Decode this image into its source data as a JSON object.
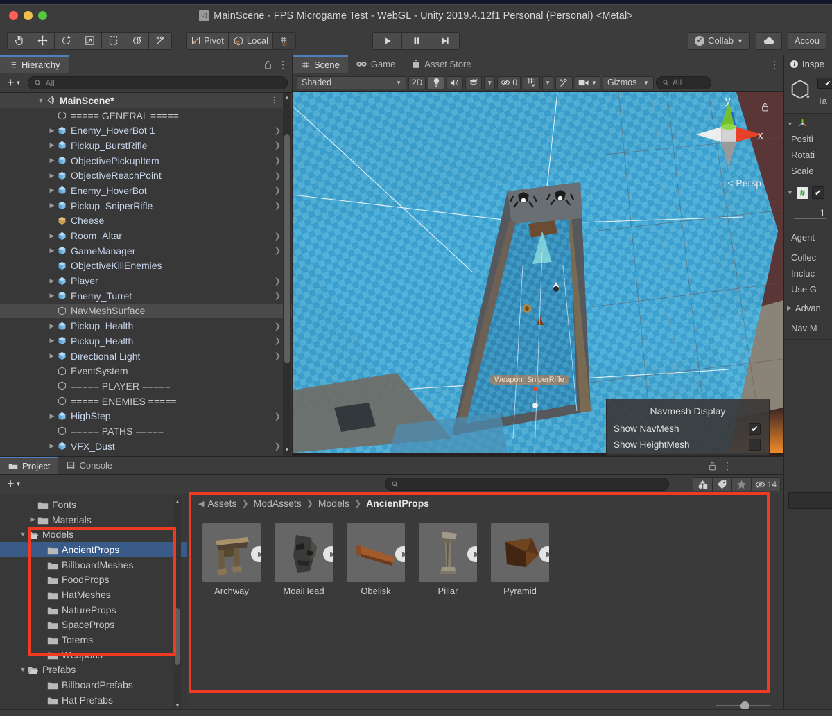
{
  "window": {
    "title": "MainScene - FPS Microgame Test - WebGL - Unity 2019.4.12f1 Personal (Personal) <Metal>",
    "logo_icon": "unity-logo-icon"
  },
  "toolbar": {
    "tools": [
      {
        "name": "hand-tool",
        "icon": "hand-icon"
      },
      {
        "name": "move-tool",
        "icon": "move-icon"
      },
      {
        "name": "rotate-tool",
        "icon": "rotate-icon"
      },
      {
        "name": "scale-tool",
        "icon": "scale-icon"
      },
      {
        "name": "rect-tool",
        "icon": "rect-transform-icon"
      },
      {
        "name": "transform-tool",
        "icon": "transform-icon"
      },
      {
        "name": "custom-editor-tool",
        "icon": "wrench-icon"
      }
    ],
    "pivot_label": "Pivot",
    "local_label": "Local",
    "snap_icon": "grid-snap-icon",
    "play_label": "",
    "pause_label": "",
    "step_label": "",
    "collab_label": "Collab",
    "cloud_icon": "cloud-icon",
    "account_label": "Accou"
  },
  "hierarchy": {
    "tab_label": "Hierarchy",
    "tab_icon": "hierarchy-icon",
    "lock_icon": "lock-icon",
    "menu_icon": "kebab-menu-icon",
    "add_label": "+",
    "search_placeholder": "All",
    "scene_name": "MainScene*",
    "items": [
      {
        "label": "===== GENERAL =====",
        "indent": 2,
        "expandable": false,
        "plain": true
      },
      {
        "label": "Enemy_HoverBot 1",
        "indent": 2,
        "expandable": true,
        "plain": false
      },
      {
        "label": "Pickup_BurstRifle",
        "indent": 2,
        "expandable": true,
        "plain": false
      },
      {
        "label": "ObjectivePickupItem",
        "indent": 2,
        "expandable": true,
        "plain": false
      },
      {
        "label": "ObjectiveReachPoint",
        "indent": 2,
        "expandable": true,
        "plain": false
      },
      {
        "label": "Enemy_HoverBot",
        "indent": 2,
        "expandable": true,
        "plain": false
      },
      {
        "label": "Pickup_SniperRifle",
        "indent": 2,
        "expandable": true,
        "plain": false
      },
      {
        "label": "Cheese",
        "indent": 2,
        "expandable": false,
        "plain": false
      },
      {
        "label": "Room_Altar",
        "indent": 2,
        "expandable": true,
        "plain": false
      },
      {
        "label": "GameManager",
        "indent": 2,
        "expandable": true,
        "plain": false
      },
      {
        "label": "ObjectiveKillEnemies",
        "indent": 2,
        "expandable": false,
        "plain": false
      },
      {
        "label": "Player",
        "indent": 2,
        "expandable": true,
        "plain": false
      },
      {
        "label": "Enemy_Turret",
        "indent": 2,
        "expandable": true,
        "plain": false
      },
      {
        "label": "NavMeshSurface",
        "indent": 2,
        "expandable": false,
        "plain": true,
        "selected": true
      },
      {
        "label": "Pickup_Health",
        "indent": 2,
        "expandable": true,
        "plain": false
      },
      {
        "label": "Pickup_Health",
        "indent": 2,
        "expandable": true,
        "plain": false
      },
      {
        "label": "Directional Light",
        "indent": 2,
        "expandable": true,
        "plain": false
      },
      {
        "label": "EventSystem",
        "indent": 2,
        "expandable": false,
        "plain": true
      },
      {
        "label": "===== PLAYER =====",
        "indent": 2,
        "expandable": false,
        "plain": true
      },
      {
        "label": "===== ENEMIES =====",
        "indent": 2,
        "expandable": false,
        "plain": true
      },
      {
        "label": "HighStep",
        "indent": 2,
        "expandable": true,
        "plain": false
      },
      {
        "label": "===== PATHS =====",
        "indent": 2,
        "expandable": false,
        "plain": true
      },
      {
        "label": "VFX_Dust",
        "indent": 2,
        "expandable": true,
        "plain": false
      }
    ]
  },
  "scene": {
    "tabs": [
      {
        "label": "Scene",
        "icon": "grid-icon",
        "active": true
      },
      {
        "label": "Game",
        "icon": "gamepad-icon",
        "active": false
      },
      {
        "label": "Asset Store",
        "icon": "store-bag-icon",
        "active": false
      }
    ],
    "menu_icon": "kebab-menu-icon",
    "draw_mode": "Shaded",
    "two_d_label": "2D",
    "light_icon": "lightbulb-icon",
    "audio_icon": "speaker-icon",
    "fx_icon": "fx-icon",
    "hidden_count": "0",
    "hidden_icon": "eye-off-icon",
    "grid_icon": "grid-visibility-icon",
    "tools_icon": "wrench-icon",
    "camera_icon": "camera-icon",
    "gizmos_label": "Gizmos",
    "search_placeholder": "All",
    "gizmo": {
      "y_label": "y",
      "x_label": "x",
      "persp_label": "< Persp",
      "lock_icon": "lock-icon"
    },
    "object_label": "Weapon_SniperRifle",
    "navmesh_popup": {
      "title": "Navmesh Display",
      "options": [
        {
          "label": "Show NavMesh",
          "checked": true
        },
        {
          "label": "Show HeightMesh",
          "checked": false
        }
      ]
    }
  },
  "inspector": {
    "tab_label": "Inspe",
    "tab_icon": "info-icon",
    "tag_label": "Ta",
    "transform_icon": "transform-axis-icon",
    "fields": [
      "Positi",
      "Rotati",
      "Scale"
    ],
    "script_icon": "script-icon",
    "number_value": "1",
    "nav_fields": [
      "Agent",
      "Collec",
      "Incluc",
      "Use G"
    ],
    "advanced_label": "Advan",
    "nav_label": "Nav M"
  },
  "project": {
    "tabs": [
      {
        "label": "Project",
        "icon": "folder-icon",
        "active": true
      },
      {
        "label": "Console",
        "icon": "console-icon",
        "active": false
      }
    ],
    "lock_icon": "lock-icon",
    "menu_icon": "kebab-menu-icon",
    "add_label": "+",
    "search_placeholder": "",
    "search_icon": "search-icon",
    "filter_buttons": [
      {
        "name": "type-filter-button",
        "icon": "shapes-icon",
        "label": ""
      },
      {
        "name": "label-filter-button",
        "icon": "tag-icon",
        "label": ""
      },
      {
        "name": "favorites-button",
        "icon": "star-icon",
        "label": ""
      },
      {
        "name": "hidden-count-button",
        "icon": "eye-off-icon",
        "label": "14"
      }
    ],
    "tree": [
      {
        "label": "Fonts",
        "indent": 2,
        "expandable": false,
        "open": false
      },
      {
        "label": "Materials",
        "indent": 2,
        "expandable": true,
        "open": false
      },
      {
        "label": "Models",
        "indent": 1,
        "expandable": true,
        "open": true
      },
      {
        "label": "AncientProps",
        "indent": 3,
        "expandable": false,
        "open": false,
        "selected": true
      },
      {
        "label": "BillboardMeshes",
        "indent": 3,
        "expandable": false,
        "open": false
      },
      {
        "label": "FoodProps",
        "indent": 3,
        "expandable": false,
        "open": false
      },
      {
        "label": "HatMeshes",
        "indent": 3,
        "expandable": false,
        "open": false
      },
      {
        "label": "NatureProps",
        "indent": 3,
        "expandable": false,
        "open": false
      },
      {
        "label": "SpaceProps",
        "indent": 3,
        "expandable": false,
        "open": false
      },
      {
        "label": "Totems",
        "indent": 3,
        "expandable": false,
        "open": false
      },
      {
        "label": "Weapons",
        "indent": 3,
        "expandable": false,
        "open": false
      },
      {
        "label": "Prefabs",
        "indent": 1,
        "expandable": true,
        "open": true
      },
      {
        "label": "BillboardPrefabs",
        "indent": 3,
        "expandable": false,
        "open": false
      },
      {
        "label": "Hat Prefabs",
        "indent": 3,
        "expandable": false,
        "open": false
      }
    ],
    "breadcrumb": [
      "Assets",
      "ModAssets",
      "Models",
      "AncientProps"
    ],
    "assets": [
      {
        "name": "Archway",
        "thumb": "archway-thumbnail"
      },
      {
        "name": "MoaiHead",
        "thumb": "moaihead-thumbnail"
      },
      {
        "name": "Obelisk",
        "thumb": "obelisk-thumbnail"
      },
      {
        "name": "Pillar",
        "thumb": "pillar-thumbnail"
      },
      {
        "name": "Pyramid",
        "thumb": "pyramid-thumbnail"
      }
    ]
  },
  "colors": {
    "highlight_red": "#f23a21",
    "selection_blue": "#3a5a87",
    "accent_blue": "#4f7fbf",
    "hierarchy_text": "#c7d4ea"
  }
}
